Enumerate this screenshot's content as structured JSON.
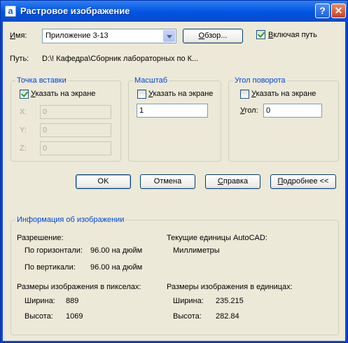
{
  "titlebar": {
    "title": "Растровое изображение",
    "app_icon": "a",
    "help_glyph": "?",
    "close_glyph": "✕"
  },
  "name_row": {
    "label_u": "И",
    "label_rest": "мя:",
    "value": "Приложение 3-13",
    "browse_u": "О",
    "browse_rest": "бзор...",
    "include_path_u": "В",
    "include_path_rest": "ключая путь",
    "include_path_checked": true
  },
  "path_row": {
    "label": "Путь:",
    "value": "D:\\! Кафедра\\Сборник лабораторных по К..."
  },
  "insert_point": {
    "title": "Точка вставки",
    "on_screen_u": "У",
    "on_screen_rest": "казать на экране",
    "on_screen_checked": true,
    "x_label": "X:",
    "x_value": "0",
    "y_label": "Y:",
    "y_value": "0",
    "z_label": "Z:",
    "z_value": "0"
  },
  "scale": {
    "title": "Масштаб",
    "on_screen_u": "У",
    "on_screen_rest": "казать на экране",
    "on_screen_checked": false,
    "value": "1"
  },
  "rotation": {
    "title": "Угол поворота",
    "on_screen_u": "У",
    "on_screen_rest": "казать на экране",
    "on_screen_checked": false,
    "angle_label_u": "У",
    "angle_label_rest": "гол:",
    "value": "0"
  },
  "buttons": {
    "ok": "OK",
    "cancel": "Отмена",
    "help_u": "С",
    "help_rest": "правка",
    "details_u": "П",
    "details_rest": "одробнее <<"
  },
  "info": {
    "title": "Информация об изображении",
    "resolution_label": "Разрешение:",
    "horiz_label": "По горизонтали:",
    "horiz_value": "96.00 на дюйм",
    "vert_label": "По вертикали:",
    "vert_value": "96.00 на дюйм",
    "units_label": "Текущие единицы AutoCAD:",
    "units_value": "Миллиметры",
    "pixels_label": "Размеры изображения в пикселах:",
    "px_width_label": "Ширина:",
    "px_width_value": "889",
    "px_height_label": "Высота:",
    "px_height_value": "1069",
    "units_size_label": "Размеры изображения в единицах:",
    "u_width_label": "Ширина:",
    "u_width_value": "235.215",
    "u_height_label": "Высота:",
    "u_height_value": "282.84"
  }
}
